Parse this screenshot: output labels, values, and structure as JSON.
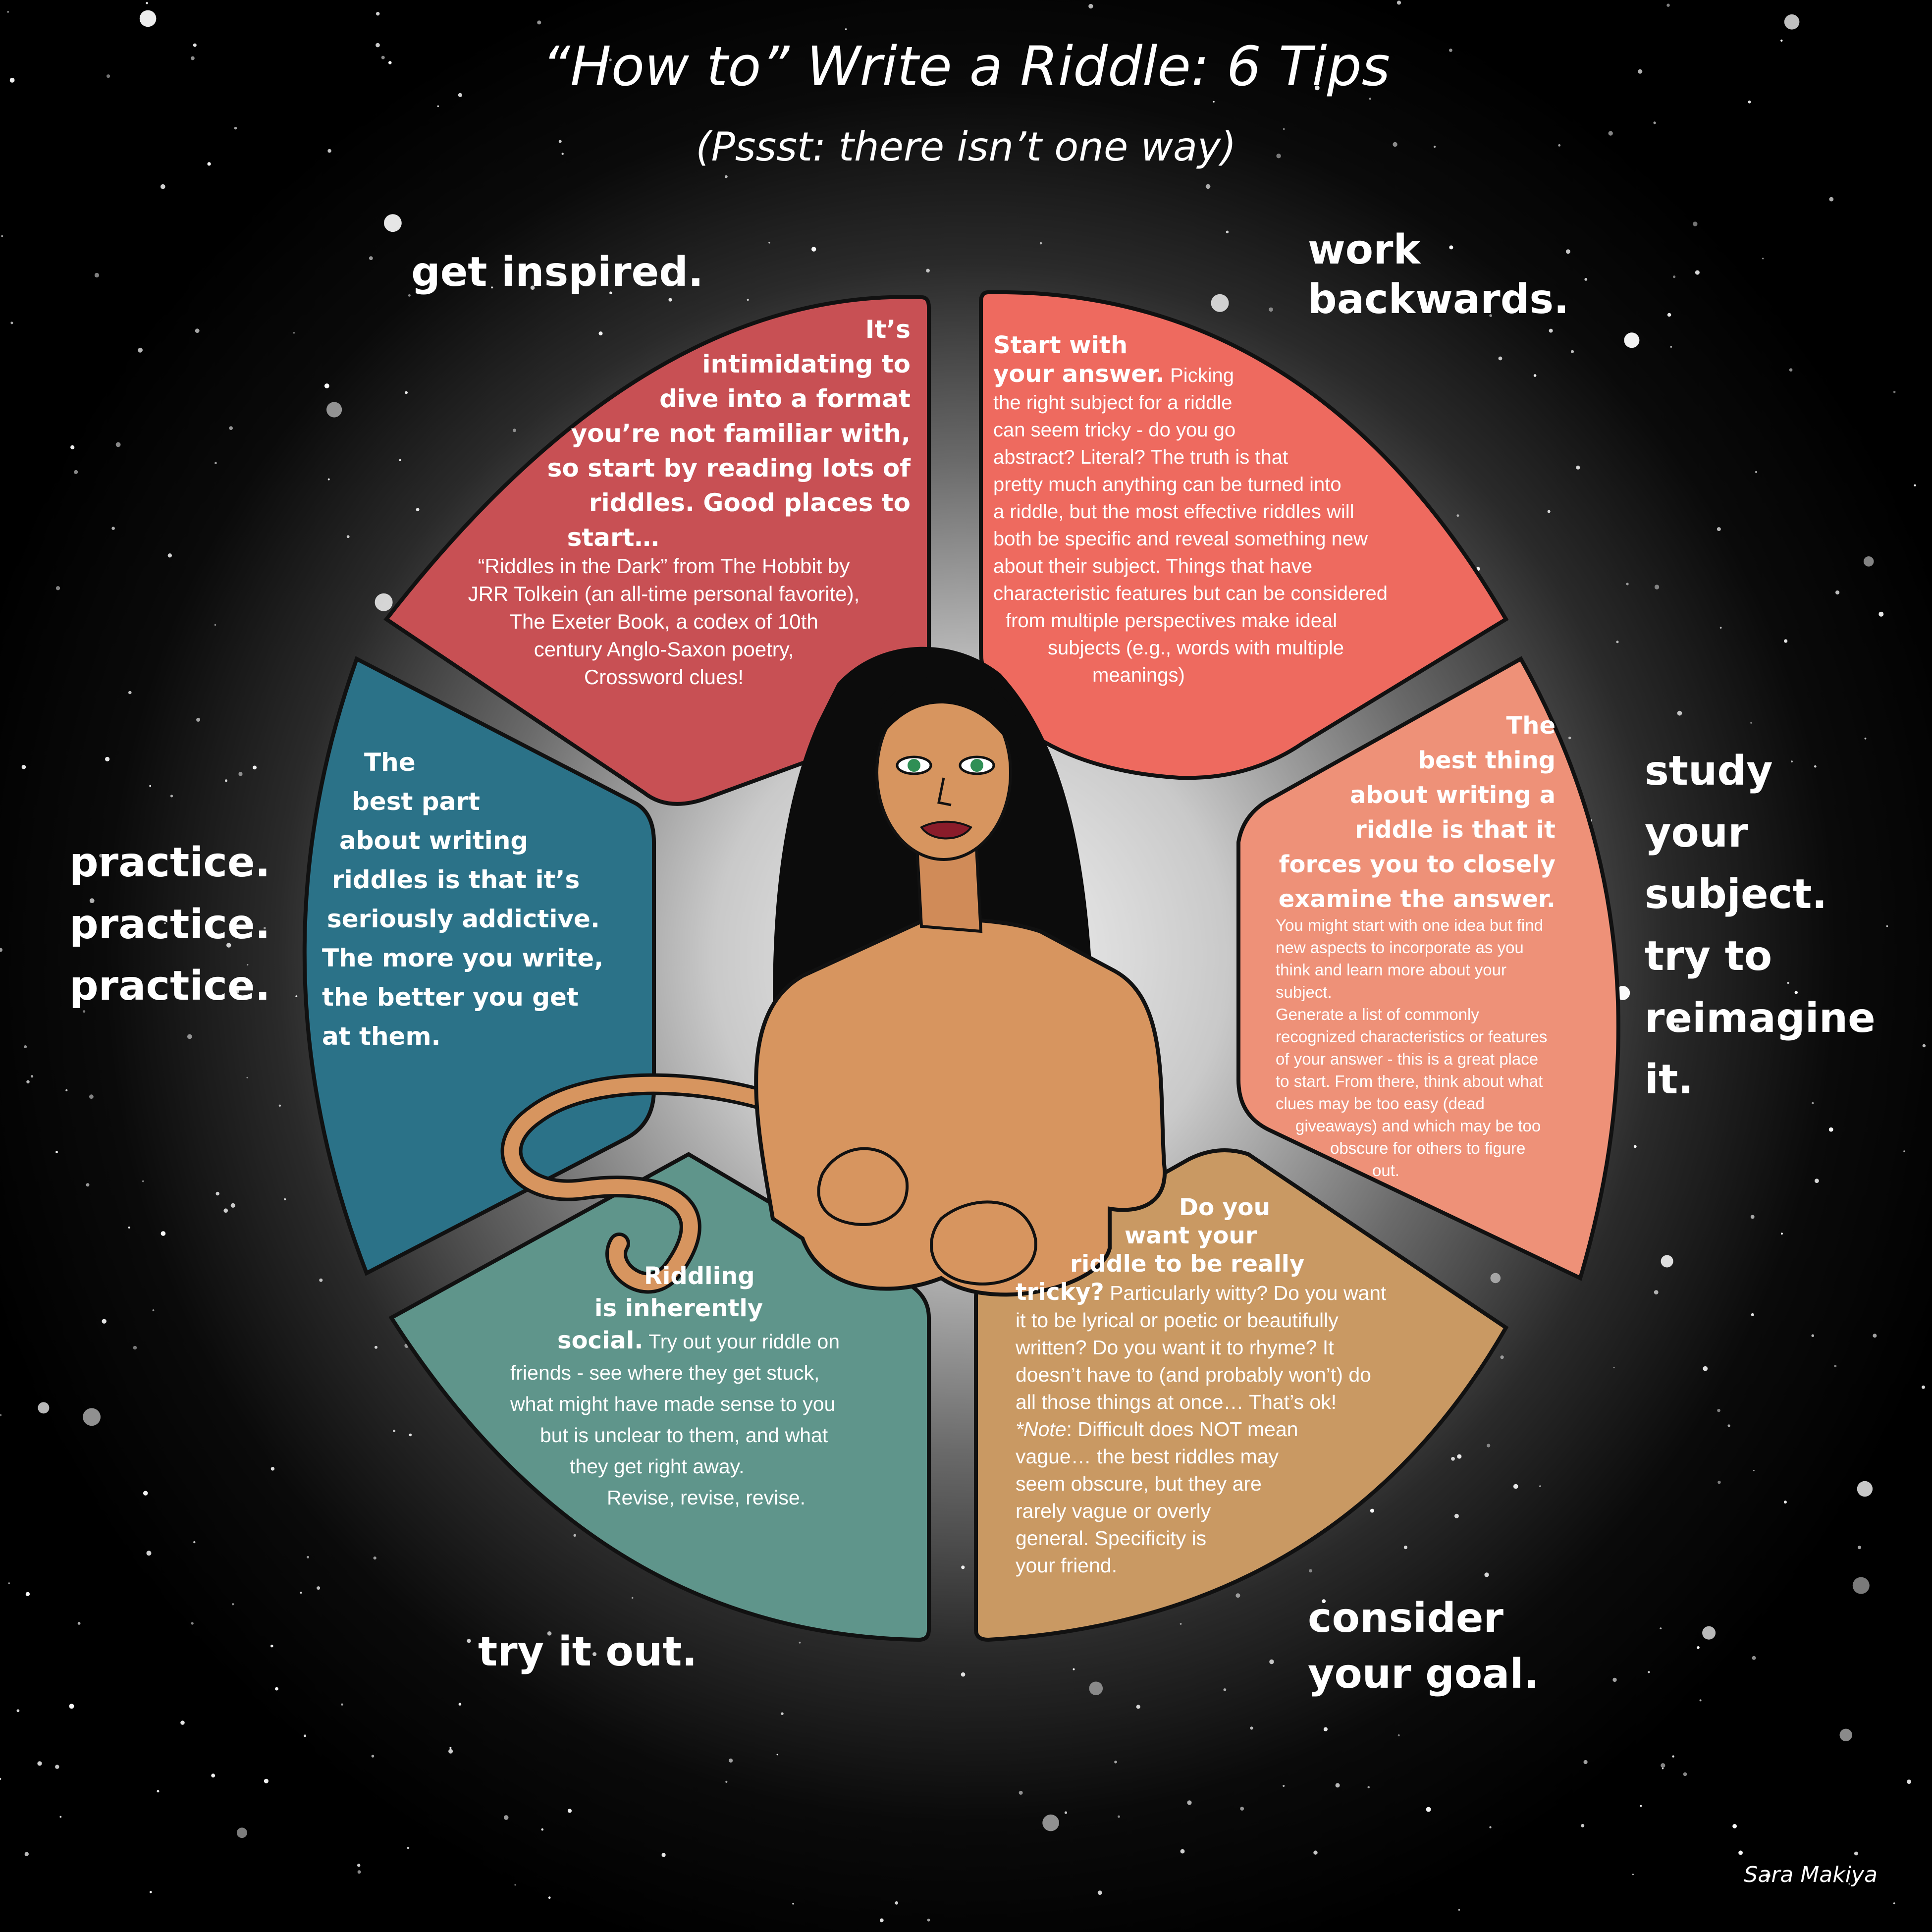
{
  "title": "“How to” Write a Riddle: 6 Tips",
  "subtitle": "(Pssst: there isn’t one way)",
  "credit": "Sara Makiya",
  "colors": {
    "get_inspired": "#c85054",
    "work_backwards": "#ee6a5f",
    "study_subject": "#ee9178",
    "consider_goal": "#c99963",
    "try_it_out": "#5f958b",
    "practice": "#2b7288",
    "sphinx_skin": "#d7955f",
    "hair": "#0c0c0c"
  },
  "tips": {
    "get_inspired": {
      "heading": "get inspired.",
      "bold_lines": [
        "It’s",
        "intimidating to",
        "dive into a format",
        "you’re not familiar with,",
        "so start by reading lots of",
        "riddles. Good places to",
        "start…"
      ],
      "body_lines": [
        "“Riddles in the Dark” from The Hobbit by",
        "JRR Tolkein (an all-time personal favorite),",
        "The Exeter Book, a codex of 10th",
        "century Anglo-Saxon poetry,",
        "Crossword clues!"
      ]
    },
    "work_backwards": {
      "heading_lines": [
        "work",
        "backwards."
      ],
      "lines": [
        {
          "bold": "Start with",
          "rest": ""
        },
        {
          "bold": "your answer.",
          "rest": " Picking"
        },
        {
          "bold": "",
          "rest": "the right subject for a riddle"
        },
        {
          "bold": "",
          "rest": "can seem tricky - do you go"
        },
        {
          "bold": "",
          "rest": "abstract? Literal? The truth is that"
        },
        {
          "bold": "",
          "rest": "pretty much anything can be turned into"
        },
        {
          "bold": "",
          "rest": "a riddle, but the most effective riddles will"
        },
        {
          "bold": "",
          "rest": "both be specific and reveal something new"
        },
        {
          "bold": "",
          "rest": "about their subject. Things that have"
        },
        {
          "bold": "",
          "rest": "characteristic features but can be considered"
        },
        {
          "bold": "",
          "rest": "from multiple perspectives make ideal"
        },
        {
          "bold": "",
          "rest": "subjects (e.g., words with multiple"
        },
        {
          "bold": "",
          "rest": "meanings)"
        }
      ]
    },
    "study_subject": {
      "heading_lines": [
        "study",
        "your",
        "subject.",
        "try to",
        "reimagine",
        "it."
      ],
      "bold_lines": [
        "The",
        "best thing",
        "about writing a",
        "riddle is that it",
        "forces you to closely",
        "examine the answer."
      ],
      "body_lines": [
        "You might start with one idea but find",
        "new aspects to incorporate as you",
        "think and learn more about your",
        "subject.",
        "Generate a list of commonly",
        "recognized characteristics or features",
        "of your answer - this is a great place",
        "to start. From there, think about what",
        "clues may be too easy (dead",
        "giveaways) and which may be too",
        "obscure for others to figure",
        "out."
      ]
    },
    "consider_goal": {
      "heading_lines": [
        "consider",
        "your goal."
      ],
      "lines": [
        {
          "bold": "Do you",
          "rest": ""
        },
        {
          "bold": "want your",
          "rest": ""
        },
        {
          "bold": "riddle to be really",
          "rest": ""
        },
        {
          "bold": "tricky?",
          "rest": " Particularly witty? Do you want"
        },
        {
          "bold": "",
          "rest": "it to be lyrical or poetic or beautifully"
        },
        {
          "bold": "",
          "rest": "written? Do you want it to rhyme? It"
        },
        {
          "bold": "",
          "rest": "doesn’t have to (and probably won’t) do"
        },
        {
          "bold": "",
          "rest": "all those things at once… That’s ok!"
        },
        {
          "bold": "",
          "italic": "*Note",
          "rest": ": Difficult does NOT mean"
        },
        {
          "bold": "",
          "rest": "vague… the best riddles may"
        },
        {
          "bold": "",
          "rest": "seem obscure, but they are"
        },
        {
          "bold": "",
          "rest": "rarely vague or overly"
        },
        {
          "bold": "",
          "rest": "general. Specificity is"
        },
        {
          "bold": "",
          "rest": "your friend."
        }
      ]
    },
    "try_it_out": {
      "heading": "try it out.",
      "lines": [
        {
          "bold": "Riddling",
          "rest": ""
        },
        {
          "bold": "is inherently",
          "rest": ""
        },
        {
          "bold": "social.",
          "rest": " Try out your riddle on"
        },
        {
          "bold": "",
          "rest": "friends - see where they get stuck,"
        },
        {
          "bold": "",
          "rest": "what might have made sense to you"
        },
        {
          "bold": "",
          "rest": "but is unclear to them, and what"
        },
        {
          "bold": "",
          "rest": "they get right away."
        },
        {
          "bold": "",
          "rest": "Revise, revise, revise."
        }
      ]
    },
    "practice": {
      "heading_lines": [
        "practice.",
        "practice.",
        "practice."
      ],
      "bold_lines": [
        "The",
        "best part",
        "about writing",
        "riddles is that it’s",
        "seriously addictive.",
        "The more you write,",
        "the better you get",
        "at them."
      ]
    }
  }
}
